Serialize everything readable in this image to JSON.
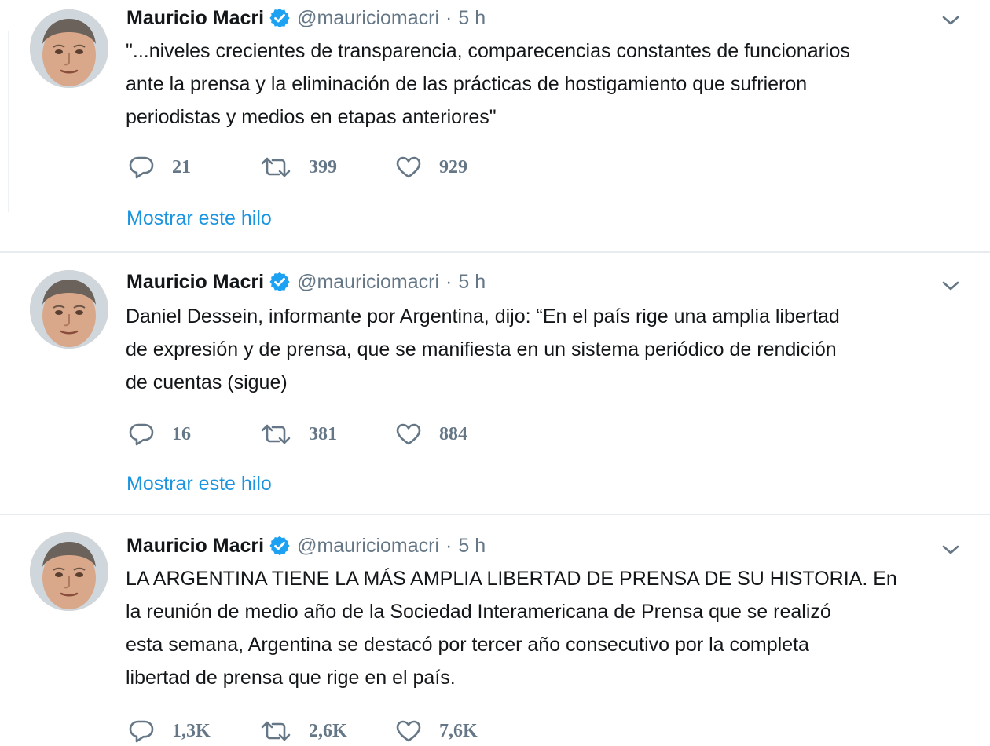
{
  "tweets": [
    {
      "author": "Mauricio Macri",
      "handle": "@mauriciomacri",
      "separator": "·",
      "time": "5 h",
      "lines": [
        "\"...niveles crecientes de transparencia, comparecencias constantes de funcionarios",
        "ante la prensa y la eliminación de las prácticas de hostigamiento que sufrieron",
        "periodistas y medios en etapas anteriores\""
      ],
      "replies": "21",
      "retweets": "399",
      "likes": "929",
      "thread_link": "Mostrar este hilo"
    },
    {
      "author": "Mauricio Macri",
      "handle": "@mauriciomacri",
      "separator": "·",
      "time": "5 h",
      "lines": [
        "Daniel Dessein, informante por Argentina, dijo: “En el país rige una amplia libertad",
        "de expresión y de prensa, que se manifiesta en un sistema periódico de rendición",
        "de cuentas (sigue)"
      ],
      "replies": "16",
      "retweets": "381",
      "likes": "884",
      "thread_link": "Mostrar este hilo"
    },
    {
      "author": "Mauricio Macri",
      "handle": "@mauriciomacri",
      "separator": "·",
      "time": "5 h",
      "lines": [
        "LA ARGENTINA TIENE LA MÁS AMPLIA LIBERTAD DE PRENSA DE SU HISTORIA. En",
        "la reunión de medio año de la Sociedad Interamericana de Prensa que se realizó",
        "esta semana, Argentina se destacó por tercer año consecutivo por la completa",
        "libertad de prensa que rige en el país."
      ],
      "replies": "1,3K",
      "retweets": "2,6K",
      "likes": "7,6K"
    }
  ],
  "icons": {
    "verified": "verified-badge-icon",
    "caret": "chevron-down-icon",
    "reply": "reply-icon",
    "retweet": "retweet-icon",
    "like": "heart-icon"
  },
  "colors": {
    "link": "#1b95e0",
    "secondary_text": "#657786",
    "verified": "#1da1f2",
    "divider": "#e6ecf0"
  }
}
